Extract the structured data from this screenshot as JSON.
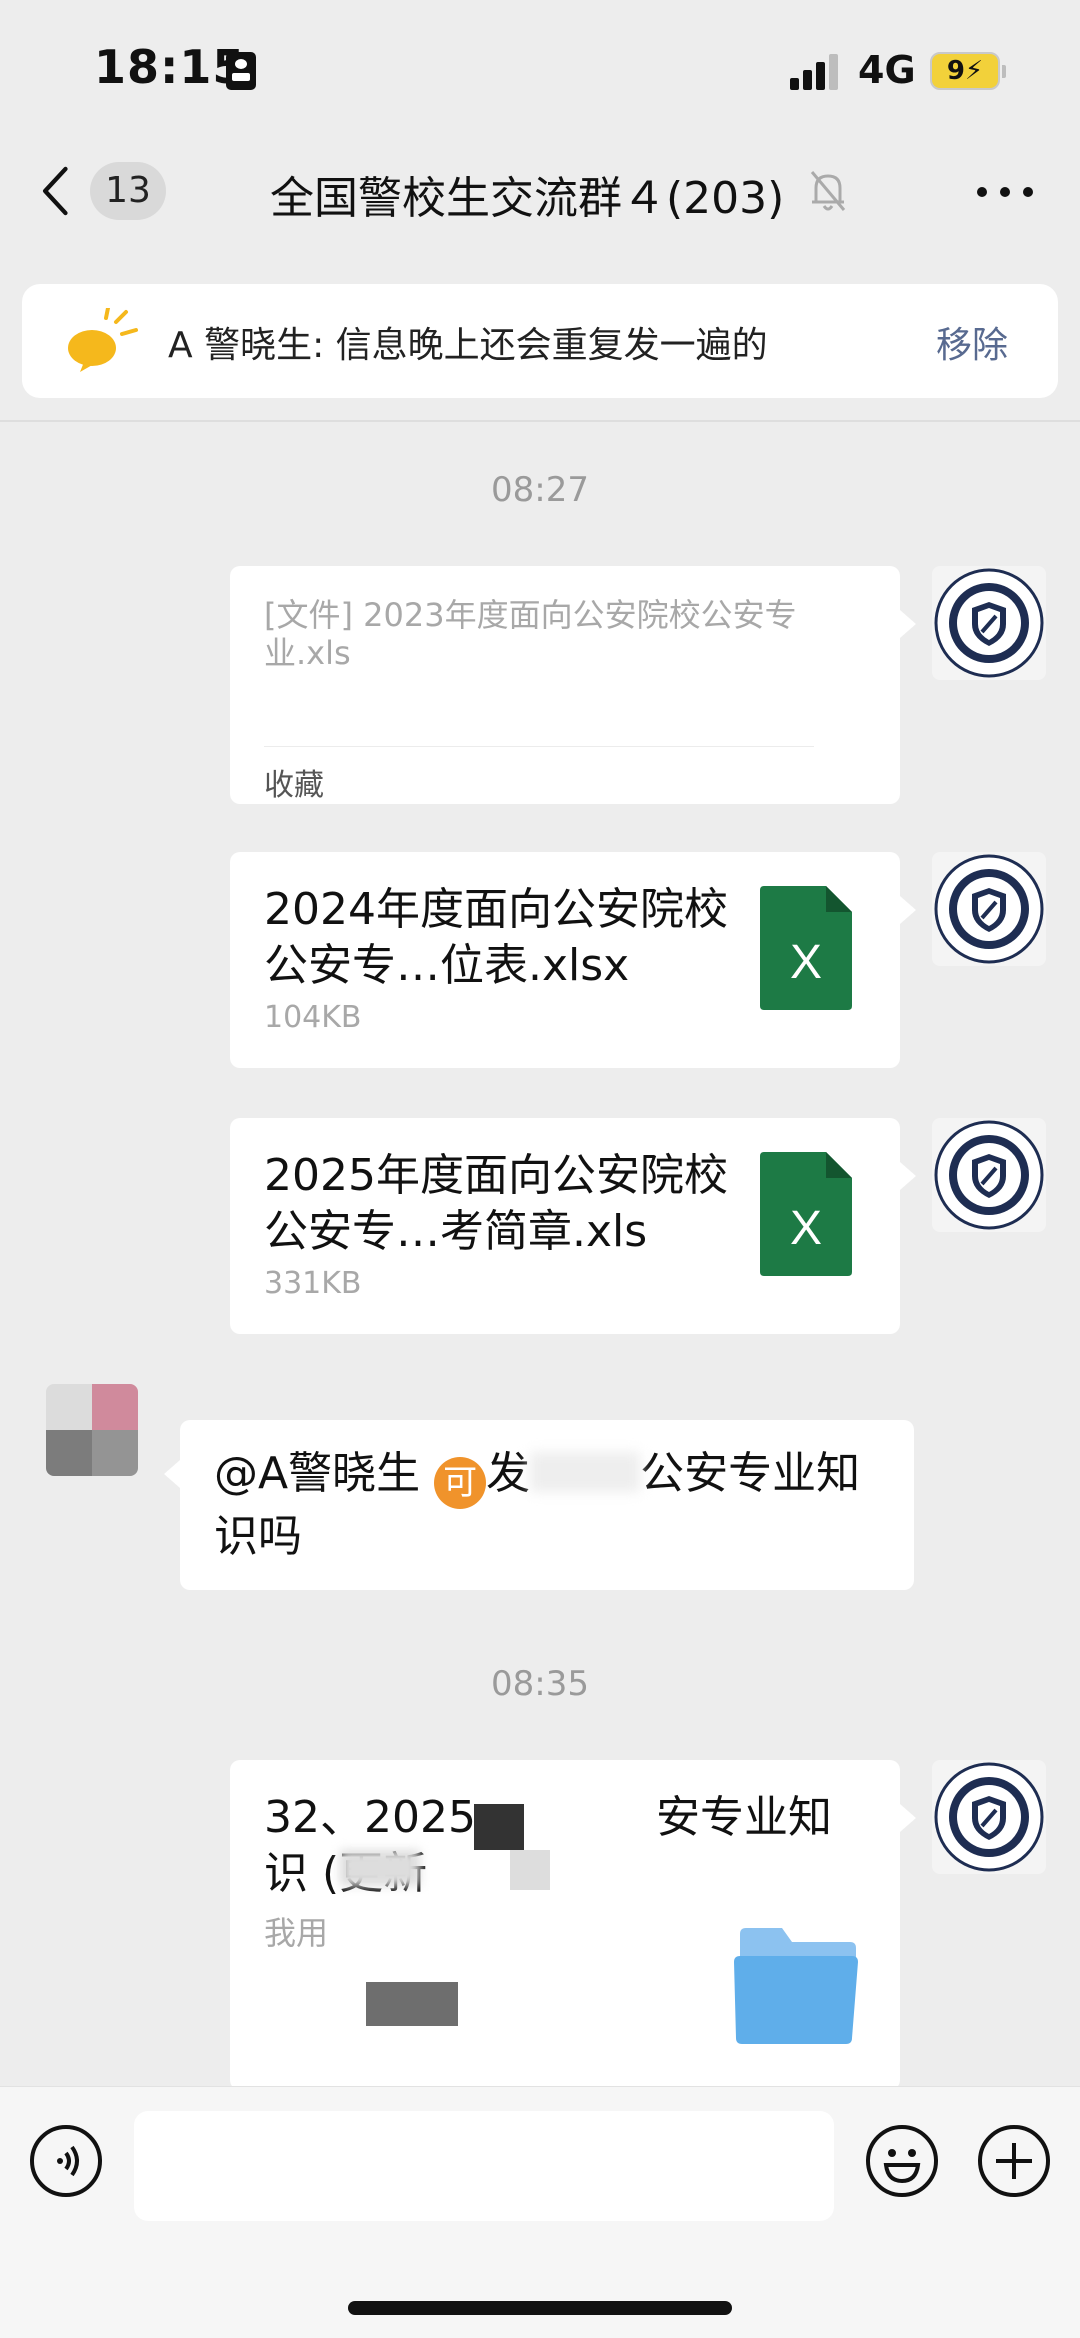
{
  "status_bar": {
    "time": "18:15",
    "network": "4G",
    "battery": "9"
  },
  "header": {
    "unread_count": "13",
    "title": "全国警校生交流群４(203)"
  },
  "pinned": {
    "text": "A 警晓生: 信息晚上还会重复发一遍的",
    "remove_label": "移除"
  },
  "messages": {
    "time1": "08:27",
    "fav": {
      "text": "[文件] 2023年度面向公安院校公安专业.xls",
      "label": "收藏"
    },
    "file1": {
      "name": "2024年度面向公安院校公安专…位表.xlsx",
      "size": "104KB",
      "icon_letter": "X"
    },
    "file2": {
      "name": "2025年度面向公安院校公安专…考简章.xls",
      "size": "331KB",
      "icon_letter": "X"
    },
    "other_msg": {
      "mention": "@A警晓生",
      "emoji": "可",
      "text_after": "发",
      "text_tail": "公安专业知识吗"
    },
    "time2": "08:35",
    "link": {
      "title_start": "32、2025",
      "title_end": "安专业知",
      "title_line2": "识 (更新",
      "sub": "我用"
    }
  },
  "colors": {
    "excel_green": "#1d7a45",
    "link_blue": "#586a90",
    "bg": "#ededed"
  }
}
